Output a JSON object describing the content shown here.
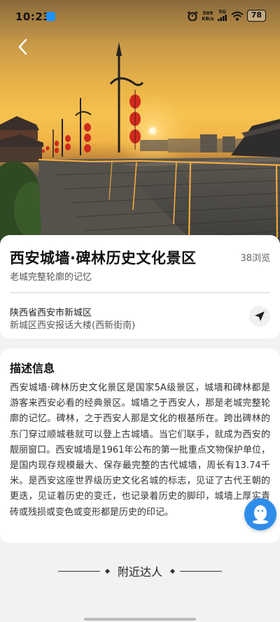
{
  "status_bar": {
    "time": "10:23",
    "net_speed_value": "509",
    "net_speed_unit": "KB/s",
    "signal_label": "5G",
    "battery": "78"
  },
  "place": {
    "title": "西安城墙·碑林历史文化景区",
    "views": "38浏览",
    "subtitle": "老城完整轮廓的记忆",
    "address_region": "陕西省西安市新城区",
    "address_detail": "新城区西安报话大楼(西新街南)"
  },
  "description": {
    "heading": "描述信息",
    "body": "西安城墙·碑林历史文化景区是国家5A级景区，城墙和碑林都是游客来西安必看的经典景区。城墙之于西安人，那是老城完整轮廓的记忆。碑林，之于西安人那是文化的根基所在。跨出碑林的东门穿过顺城巷就可以登上古城墙。当它们联手，就成为西安的靓丽窗口。西安城墙是1961年公布的第一批重点文物保护单位，是国内现存规模最大、保存最完整的古代城墙，周长有13.74千米。是西安这座世界级历史文化名城的标志，见证了古代王朝的更迭，见证着历史的变迁，也记录着历史的脚印，城墙上厚实青砖或残损或变色或变形都是历史的印记。"
  },
  "nearby": {
    "heading": "附近达人"
  },
  "icons": {
    "back": "chevron-left-icon",
    "navigate": "navigation-arrow-icon",
    "float": "qq-penguin-icon"
  },
  "colors": {
    "accent_blue": "#2f8dea",
    "sky_gold": "#f6c24f"
  }
}
